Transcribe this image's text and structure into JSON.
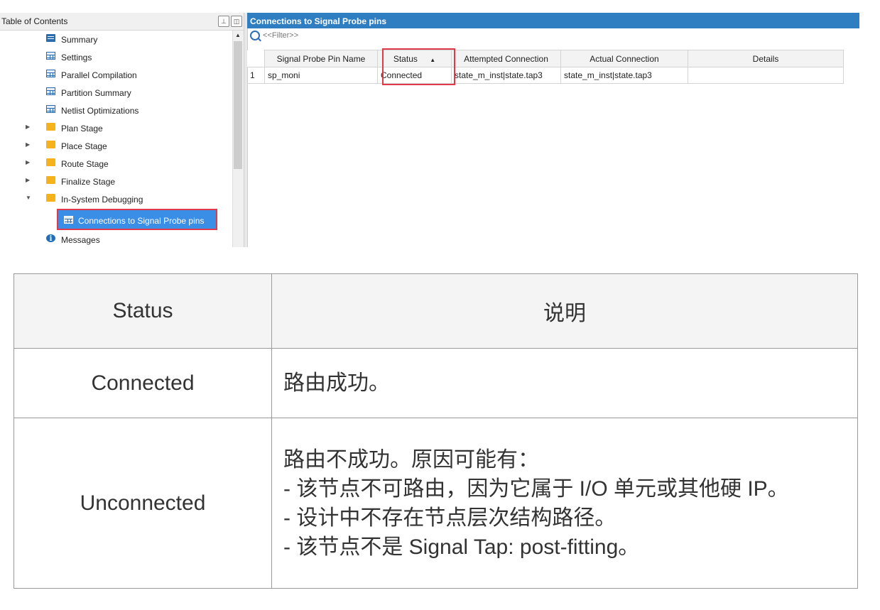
{
  "toc": {
    "title": "Table of Contents",
    "pin_icon": "pin-icon",
    "float_icon": "float-window-icon",
    "items": [
      {
        "label": "Summary",
        "icon": "summary-icon"
      },
      {
        "label": "Settings",
        "icon": "table-icon"
      },
      {
        "label": "Parallel Compilation",
        "icon": "table-icon"
      },
      {
        "label": "Partition Summary",
        "icon": "table-icon"
      },
      {
        "label": "Netlist Optimizations",
        "icon": "table-icon"
      },
      {
        "label": "Plan Stage",
        "icon": "folder-icon",
        "expanded": false
      },
      {
        "label": "Place Stage",
        "icon": "folder-icon",
        "expanded": false
      },
      {
        "label": "Route Stage",
        "icon": "folder-icon",
        "expanded": false
      },
      {
        "label": "Finalize Stage",
        "icon": "folder-icon",
        "expanded": false
      },
      {
        "label": "In-System Debugging",
        "icon": "folder-open-icon",
        "expanded": true
      },
      {
        "label": "Connections to Signal Probe pins",
        "icon": "table-icon",
        "selected": true
      },
      {
        "label": "Messages",
        "icon": "info-icon"
      }
    ]
  },
  "report": {
    "title": "Connections to Signal Probe pins",
    "filter_placeholder": "<<Filter>>",
    "columns": [
      "Signal Probe Pin Name",
      "Status",
      "Attempted Connection",
      "Actual Connection",
      "Details"
    ],
    "rows": [
      {
        "num": "1",
        "name": "sp_moni",
        "status": "Connected",
        "attempted": "state_m_inst|state.tap3",
        "actual": "state_m_inst|state.tap3",
        "details": ""
      }
    ]
  },
  "explanation": {
    "header_status": "Status",
    "header_desc": "说明",
    "rows": [
      {
        "status": "Connected",
        "lines": [
          "路由成功。"
        ]
      },
      {
        "status": "Unconnected",
        "lines": [
          "路由不成功。原因可能有：",
          "- 该节点不可路由，因为它属于 I/O 单元或其他硬 IP。",
          "- 设计中不存在节点层次结构路径。",
          "- 该节点不是 Signal Tap: post-fitting。"
        ]
      }
    ]
  },
  "colors": {
    "accent_blue": "#2f7ec1",
    "selection_blue": "#3a8ee6",
    "highlight_red": "#e03a4a",
    "folder_yellow": "#f5b21a"
  }
}
